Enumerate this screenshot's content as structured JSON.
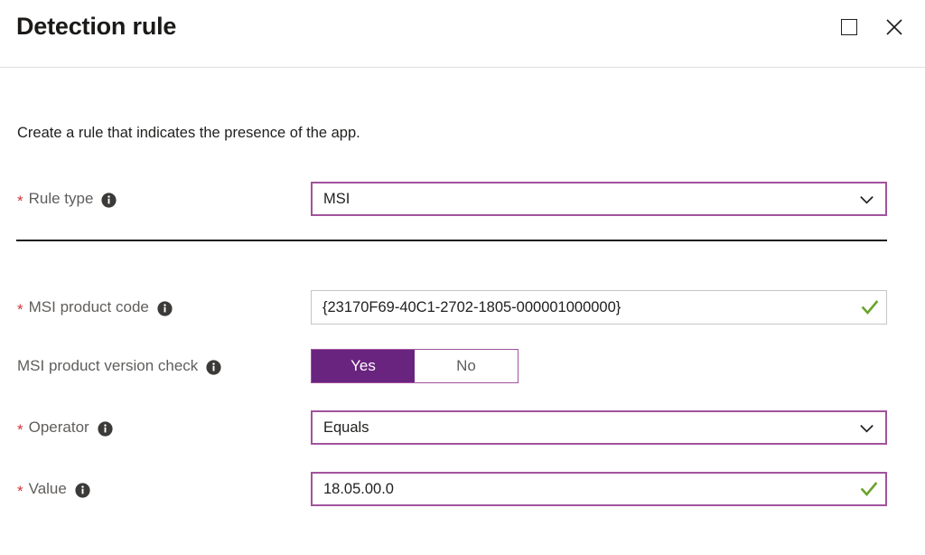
{
  "window": {
    "title": "Detection rule",
    "maximize_label": "Maximize",
    "close_label": "Close"
  },
  "colors": {
    "accent_purple": "#69247F",
    "field_border_purple": "#A2539D",
    "required_red": "#D13438",
    "valid_green": "#6AA32A",
    "label_gray": "#605E5C"
  },
  "form": {
    "description": "Create a rule that indicates the presence of the app.",
    "rows": [
      {
        "id": "rule-type",
        "label": "Rule type",
        "required": true,
        "control": "dropdown",
        "value": "MSI"
      },
      {
        "id": "msi-product-code",
        "label": "MSI product code",
        "required": true,
        "control": "textbox",
        "value": "{23170F69-40C1-2702-1805-000001000000}",
        "validated": true
      },
      {
        "id": "msi-product-version-check",
        "label": "MSI product version check",
        "required": false,
        "control": "toggle",
        "options": [
          "Yes",
          "No"
        ],
        "selected": "Yes"
      },
      {
        "id": "operator",
        "label": "Operator",
        "required": true,
        "control": "dropdown",
        "value": "Equals"
      },
      {
        "id": "value",
        "label": "Value",
        "required": true,
        "control": "textbox",
        "value": "18.05.00.0",
        "validated": true
      }
    ]
  },
  "icons": {
    "info": "info-icon",
    "chevron_down": "chevron-down-icon",
    "check": "check-icon",
    "maximize": "maximize-icon",
    "close": "close-icon"
  }
}
